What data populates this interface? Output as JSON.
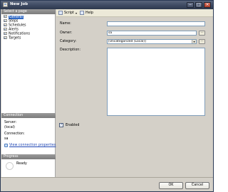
{
  "window": {
    "title": "New Job"
  },
  "sidebar": {
    "pages_header": "Select a page",
    "pages": [
      {
        "label": "General",
        "icon": "page-icon",
        "selected": true
      },
      {
        "label": "Steps",
        "icon": "page-icon",
        "selected": false
      },
      {
        "label": "Schedules",
        "icon": "page-icon",
        "selected": false
      },
      {
        "label": "Alerts",
        "icon": "page-icon",
        "selected": false
      },
      {
        "label": "Notifications",
        "icon": "page-icon",
        "selected": false
      },
      {
        "label": "Targets",
        "icon": "page-icon",
        "selected": false
      }
    ],
    "connection": {
      "header": "Connection",
      "server_label": "Server:",
      "server_value": "(local)",
      "connection_label": "Connection:",
      "connection_value": "sa",
      "link_text": "View connection properties"
    },
    "progress": {
      "header": "Progress",
      "status": "Ready"
    }
  },
  "toolbar": {
    "script_label": "Script",
    "help_label": "Help"
  },
  "form": {
    "name_label": "Name:",
    "name_value": "",
    "owner_label": "Owner:",
    "owner_value": "sa",
    "category_label": "Category:",
    "category_value": "[Uncategorized (Local)]",
    "description_label": "Description:",
    "description_value": "",
    "enabled_label": "Enabled",
    "enabled_checked": true,
    "ellipsis": "..."
  },
  "footer": {
    "ok_label": "OK",
    "cancel_label": "Cancel"
  },
  "colors": {
    "titlebar": "#3e4a61",
    "section_header": "#8a8a8a",
    "selection": "#316ac5",
    "link": "#1f46b3",
    "window_face": "#d4d0c8"
  }
}
